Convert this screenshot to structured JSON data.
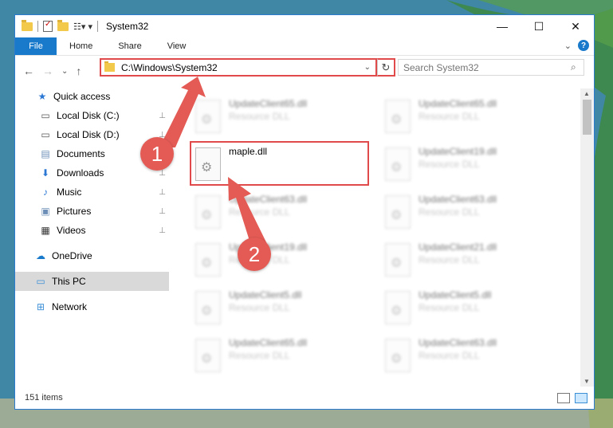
{
  "window": {
    "title": "System32",
    "controls": {
      "minimize": "—",
      "maximize": "☐",
      "close": "✕"
    }
  },
  "ribbon": {
    "tabs": [
      "File",
      "Home",
      "Share",
      "View"
    ],
    "expand_icon": "⌄",
    "help_icon": "?"
  },
  "address_bar": {
    "path": "C:\\Windows\\System32",
    "dropdown_icon": "⌄",
    "refresh_icon": "↻"
  },
  "navigation": {
    "back": "←",
    "forward": "→",
    "recent": "⌄",
    "up": "↑"
  },
  "search": {
    "placeholder": "Search System32",
    "icon": "⌕"
  },
  "nav_pane": {
    "items": [
      {
        "label": "Quick access",
        "icon": "★",
        "pinned": false,
        "color": "#2b78d4"
      },
      {
        "label": "Local Disk (C:)",
        "icon": "▭",
        "pinned": true,
        "color": "#555555"
      },
      {
        "label": "Local Disk (D:)",
        "icon": "▭",
        "pinned": true,
        "color": "#555555"
      },
      {
        "label": "Documents",
        "icon": "▤",
        "pinned": true,
        "color": "#6d8fb7"
      },
      {
        "label": "Downloads",
        "icon": "⬇",
        "pinned": true,
        "color": "#2b78d4"
      },
      {
        "label": "Music",
        "icon": "♪",
        "pinned": true,
        "color": "#2b78d4"
      },
      {
        "label": "Pictures",
        "icon": "▣",
        "pinned": true,
        "color": "#6d8fb7"
      },
      {
        "label": "Videos",
        "icon": "▦",
        "pinned": true,
        "color": "#333333"
      },
      {
        "label": "OneDrive",
        "icon": "☁",
        "pinned": false,
        "color": "#1979ca"
      },
      {
        "label": "This PC",
        "icon": "▭",
        "pinned": false,
        "color": "#3b8fd6"
      },
      {
        "label": "Network",
        "icon": "⊞",
        "pinned": false,
        "color": "#3b8fd6"
      }
    ],
    "pin_icon": "📌"
  },
  "files": [
    {
      "name": "UpdateClient65.dll",
      "type": "Resource DLL",
      "blurred": true
    },
    {
      "name": "UpdateClient65.dll",
      "type": "Resource DLL",
      "blurred": true
    },
    {
      "name": "maple.dll",
      "type": "",
      "blurred": false
    },
    {
      "name": "UpdateClient19.dll",
      "type": "Resource DLL",
      "blurred": true
    },
    {
      "name": "UpdateClient63.dll",
      "type": "Resource DLL",
      "blurred": true
    },
    {
      "name": "UpdateClient63.dll",
      "type": "Resource DLL",
      "blurred": true
    },
    {
      "name": "UpdateClient19.dll",
      "type": "Resource DLL",
      "blurred": true
    },
    {
      "name": "UpdateClient21.dll",
      "type": "Resource DLL",
      "blurred": true
    },
    {
      "name": "UpdateClient5.dll",
      "type": "Resource DLL",
      "blurred": true
    },
    {
      "name": "UpdateClient5.dll",
      "type": "Resource DLL",
      "blurred": true
    },
    {
      "name": "UpdateClient65.dll",
      "type": "Resource DLL",
      "blurred": true
    },
    {
      "name": "UpdateClient63.dll",
      "type": "Resource DLL",
      "blurred": true
    }
  ],
  "status": {
    "item_count": "151 items"
  },
  "annotations": {
    "step1": "1",
    "step2": "2",
    "color": "#e45b55"
  }
}
